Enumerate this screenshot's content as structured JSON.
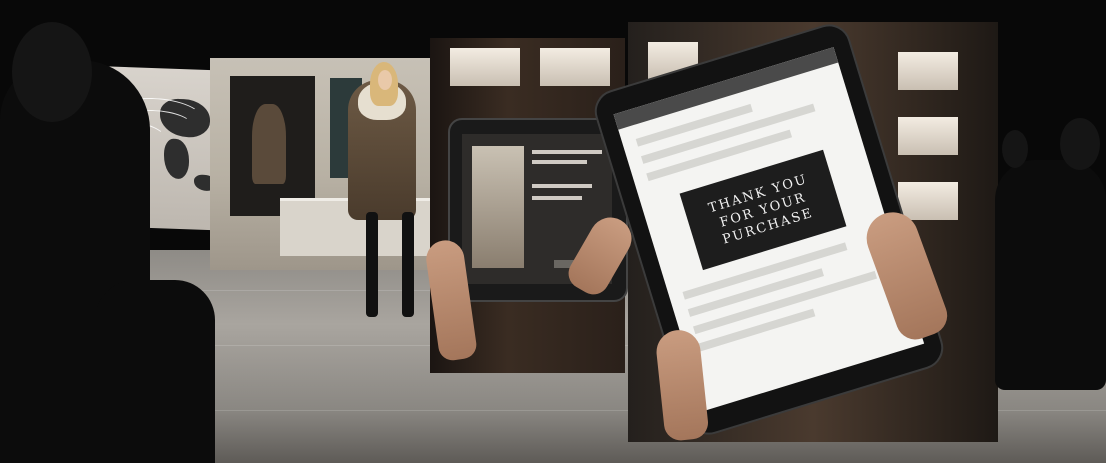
{
  "scene": {
    "palette": {
      "floor": "#a9a59f",
      "tablet_frame": "#121212",
      "screen": "#f4f4f2",
      "coat": "#6d5a45"
    },
    "tablet_message": "THANK YOU\nFOR YOUR\nPURCHASE"
  }
}
